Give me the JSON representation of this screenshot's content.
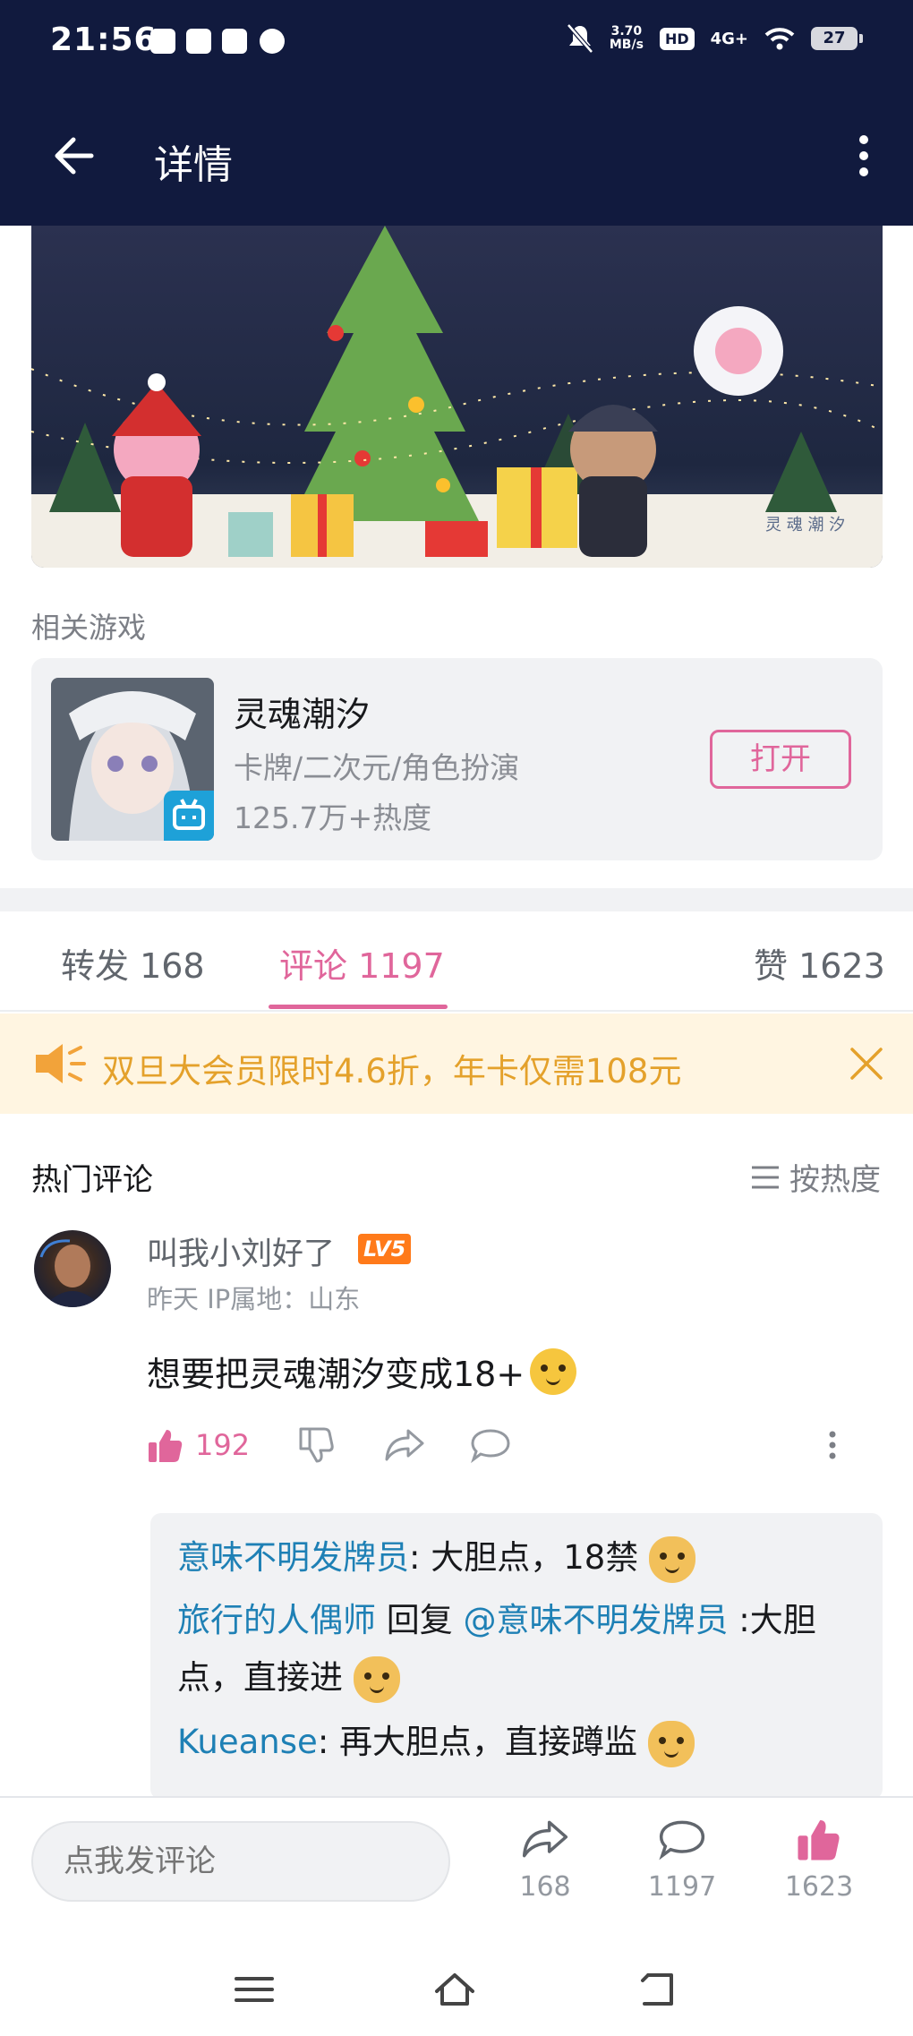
{
  "status_bar": {
    "time": "21:56",
    "net_speed_value": "3.70",
    "net_speed_unit": "MB/s",
    "hd": "HD",
    "signal": "4G+",
    "battery": "27"
  },
  "header": {
    "title": "详情",
    "back_icon": "back-arrow-icon",
    "more_icon": "more-vertical-icon"
  },
  "banner": {
    "watermark": "灵 魂 潮 汐"
  },
  "related_game": {
    "section_label": "相关游戏",
    "name": "灵魂潮汐",
    "tags": "卡牌/二次元/角色扮演",
    "heat": "125.7万+热度",
    "open_label": "打开"
  },
  "tabs": [
    {
      "label": "转发 168"
    },
    {
      "label": "评论 1197",
      "active": true
    },
    {
      "label": "赞 1623"
    }
  ],
  "promo": {
    "text": "双旦大会员限时4.6折，年卡仅需108元"
  },
  "comments_section": {
    "title": "热门评论",
    "sort_label": "按热度"
  },
  "comment": {
    "username": "叫我小刘好了",
    "level": "LV5",
    "meta": "昨天  IP属地：山东",
    "text": "想要把灵魂潮汐变成18+",
    "like_count": "192",
    "replies": [
      {
        "user": "意味不明发牌员",
        "sep": ": ",
        "text": "大胆点，18禁"
      },
      {
        "user": "旅行的人偶师",
        "mid": " 回复 ",
        "target": "@意味不明发牌员",
        "text": " :大胆点，直接进"
      },
      {
        "user": "Kueanse",
        "sep": ": ",
        "text": "再大胆点，直接蹲监"
      }
    ]
  },
  "bottom_bar": {
    "input_placeholder": "点我发评论",
    "share_count": "168",
    "comment_count": "1197",
    "like_count": "1623"
  },
  "colors": {
    "header_bg": "#111a3e",
    "accent_pink": "#e0669b",
    "link_blue": "#1e80b5",
    "promo_bg": "#fff5e1",
    "promo_text": "#e4a12b"
  }
}
